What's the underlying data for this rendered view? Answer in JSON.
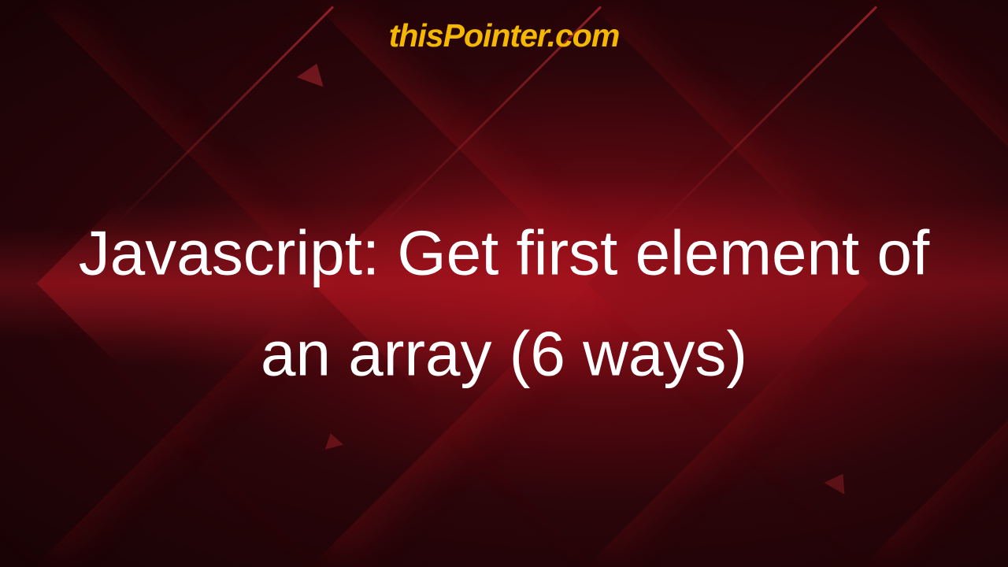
{
  "site": {
    "name": "thisPointer.com"
  },
  "article": {
    "title": "Javascript: Get first element of an array (6 ways)"
  }
}
